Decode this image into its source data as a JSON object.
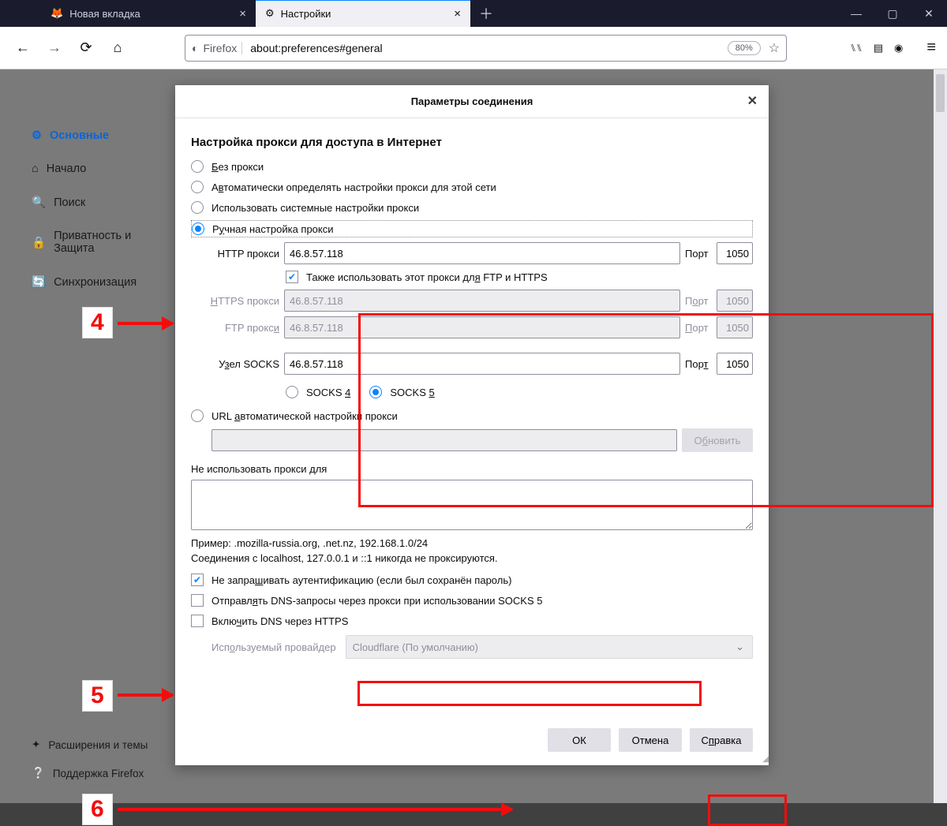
{
  "tabs": {
    "inactive": "Новая вкладка",
    "active": "Настройки"
  },
  "address": {
    "identity": "Firefox",
    "url": "about:preferences#general",
    "zoom": "80%"
  },
  "sidebar": {
    "general": "Основные",
    "home": "Начало",
    "search": "Поиск",
    "privacy1": "Приватность и",
    "privacy2": "Защита",
    "sync": "Синхронизация",
    "ext": "Расширения и темы",
    "support": "Поддержка Firefox"
  },
  "dialog": {
    "title": "Параметры соединения",
    "heading": "Настройка прокси для доступа в Интернет",
    "opt_none": "Без прокси",
    "opt_auto": "Автоматически определять настройки прокси для этой сети",
    "opt_system": "Использовать системные настройки прокси",
    "opt_manual": "Ручная настройка прокси",
    "http_label": "HTTP прокси",
    "port_label": "Порт",
    "http_host": "46.8.57.118",
    "http_port": "1050",
    "same_proxy": "Также использовать этот прокси для FTP и HTTPS",
    "https_label": "HTTPS прокси",
    "https_host": "46.8.57.118",
    "https_port": "1050",
    "ftp_label": "FTP прокси",
    "ftp_host": "46.8.57.118",
    "ftp_port": "1050",
    "socks_label": "Узел SOCKS",
    "socks_host": "46.8.57.118",
    "socks_port": "1050",
    "socks4": "SOCKS 4",
    "socks5": "SOCKS 5",
    "opt_pac": "URL автоматической настройки прокси",
    "reload": "Обновить",
    "noproxy_label": "Не использовать прокси для",
    "noproxy_hint": "Пример: .mozilla-russia.org, .net.nz, 192.168.1.0/24",
    "noproxy_note": "Соединения с localhost, 127.0.0.1 и ::1 никогда не проксируются.",
    "save_login": "Не запрашивать аутентификацию (если был сохранён пароль)",
    "socks_dns": "Отправлять DNS-запросы через прокси при использовании SOCKS 5",
    "doh": "Включить DNS через HTTPS",
    "provider_label": "Используемый провайдер",
    "provider_value": "Cloudflare (По умолчанию)",
    "ok": "ОК",
    "cancel": "Отмена",
    "help": "Справка"
  },
  "annot": {
    "n4": "4",
    "n5": "5",
    "n6": "6"
  }
}
